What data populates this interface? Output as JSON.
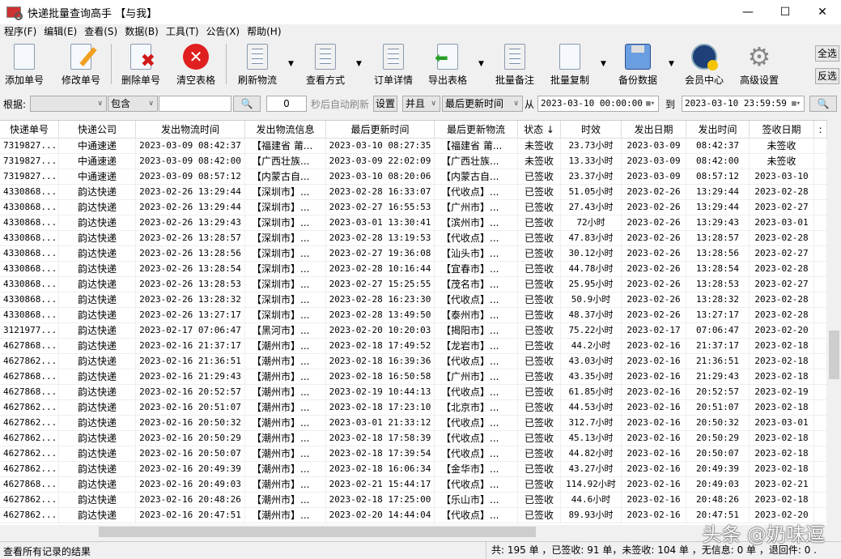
{
  "window": {
    "title": "快递批量查询高手 【与我】",
    "minimize": "—",
    "maximize": "☐",
    "close": "✕"
  },
  "menu": [
    "程序(F)",
    "编辑(E)",
    "查看(S)",
    "数据(B)",
    "工具(T)",
    "公告(X)",
    "帮助(H)"
  ],
  "toolbar": {
    "add": "添加单号",
    "edit": "修改单号",
    "delete": "删除单号",
    "clear": "清空表格",
    "refresh": "刷新物流",
    "view": "查看方式",
    "detail": "订单详情",
    "export": "导出表格",
    "remark": "批量备注",
    "copy": "批量复制",
    "backup": "备份数据",
    "member": "会员中心",
    "settings": "高级设置",
    "select_all": "全选",
    "invert": "反选"
  },
  "filter": {
    "by_label": "根据:",
    "by_value": "",
    "match": "包含",
    "keyword": "",
    "seconds": "0",
    "auto_refresh": "秒后自动刷新",
    "set": "设置",
    "logic": "并且",
    "field": "最后更新时间",
    "from_label": "从",
    "from": "2023-03-10 00:00:00",
    "to_label": "到",
    "to": "2023-03-10 23:59:59"
  },
  "columns": [
    "快递单号",
    "快递公司",
    "发出物流时间",
    "发出物流信息",
    "最后更新时间",
    "最后更新物流",
    "状态 ↓",
    "时效",
    "发出日期",
    "发出时间",
    "签收日期",
    ":"
  ],
  "rows": [
    [
      "7319827...",
      "中通速递",
      "2023-03-09 08:42:37",
      "【福建省 莆...",
      "2023-03-10 08:27:35",
      "【福建省 莆...",
      "未签收",
      "23.73小时",
      "2023-03-09",
      "08:42:37",
      "未签收"
    ],
    [
      "7319827...",
      "中通速递",
      "2023-03-09 08:42:00",
      "【广西壮族...",
      "2023-03-09 22:02:09",
      "【广西壮族...",
      "未签收",
      "13.33小时",
      "2023-03-09",
      "08:42:00",
      "未签收"
    ],
    [
      "7319827...",
      "中通速递",
      "2023-03-09 08:57:12",
      "【内蒙古自...",
      "2023-03-10 08:20:06",
      "【内蒙古自...",
      "已签收",
      "23.37小时",
      "2023-03-09",
      "08:57:12",
      "2023-03-10"
    ],
    [
      "4330868...",
      "韵达快递",
      "2023-02-26 13:29:44",
      "【深圳市】...",
      "2023-02-28 16:33:07",
      "【代收点】...",
      "已签收",
      "51.05小时",
      "2023-02-26",
      "13:29:44",
      "2023-02-28"
    ],
    [
      "4330868...",
      "韵达快递",
      "2023-02-26 13:29:44",
      "【深圳市】...",
      "2023-02-27 16:55:53",
      "【广州市】...",
      "已签收",
      "27.43小时",
      "2023-02-26",
      "13:29:44",
      "2023-02-27"
    ],
    [
      "4330868...",
      "韵达快递",
      "2023-02-26 13:29:43",
      "【深圳市】...",
      "2023-03-01 13:30:41",
      "【滨州市】...",
      "已签收",
      "72小时",
      "2023-02-26",
      "13:29:43",
      "2023-03-01"
    ],
    [
      "4330868...",
      "韵达快递",
      "2023-02-26 13:28:57",
      "【深圳市】...",
      "2023-02-28 13:19:53",
      "【代收点】...",
      "已签收",
      "47.83小时",
      "2023-02-26",
      "13:28:57",
      "2023-02-28"
    ],
    [
      "4330868...",
      "韵达快递",
      "2023-02-26 13:28:56",
      "【深圳市】...",
      "2023-02-27 19:36:08",
      "【汕头市】...",
      "已签收",
      "30.12小时",
      "2023-02-26",
      "13:28:56",
      "2023-02-27"
    ],
    [
      "4330868...",
      "韵达快递",
      "2023-02-26 13:28:54",
      "【深圳市】...",
      "2023-02-28 10:16:44",
      "【宜春市】...",
      "已签收",
      "44.78小时",
      "2023-02-26",
      "13:28:54",
      "2023-02-28"
    ],
    [
      "4330868...",
      "韵达快递",
      "2023-02-26 13:28:53",
      "【深圳市】...",
      "2023-02-27 15:25:55",
      "【茂名市】...",
      "已签收",
      "25.95小时",
      "2023-02-26",
      "13:28:53",
      "2023-02-27"
    ],
    [
      "4330868...",
      "韵达快递",
      "2023-02-26 13:28:32",
      "【深圳市】...",
      "2023-02-28 16:23:30",
      "【代收点】...",
      "已签收",
      "50.9小时",
      "2023-02-26",
      "13:28:32",
      "2023-02-28"
    ],
    [
      "4330868...",
      "韵达快递",
      "2023-02-26 13:27:17",
      "【深圳市】...",
      "2023-02-28 13:49:50",
      "【泰州市】...",
      "已签收",
      "48.37小时",
      "2023-02-26",
      "13:27:17",
      "2023-02-28"
    ],
    [
      "3121977...",
      "韵达快递",
      "2023-02-17 07:06:47",
      "【黑河市】...",
      "2023-02-20 10:20:03",
      "【揭阳市】...",
      "已签收",
      "75.22小时",
      "2023-02-17",
      "07:06:47",
      "2023-02-20"
    ],
    [
      "4627868...",
      "韵达快递",
      "2023-02-16 21:37:17",
      "【潮州市】...",
      "2023-02-18 17:49:52",
      "【龙岩市】...",
      "已签收",
      "44.2小时",
      "2023-02-16",
      "21:37:17",
      "2023-02-18"
    ],
    [
      "4627862...",
      "韵达快递",
      "2023-02-16 21:36:51",
      "【潮州市】...",
      "2023-02-18 16:39:36",
      "【代收点】...",
      "已签收",
      "43.03小时",
      "2023-02-16",
      "21:36:51",
      "2023-02-18"
    ],
    [
      "4627868...",
      "韵达快递",
      "2023-02-16 21:29:43",
      "【潮州市】...",
      "2023-02-18 16:50:58",
      "【广州市】...",
      "已签收",
      "43.35小时",
      "2023-02-16",
      "21:29:43",
      "2023-02-18"
    ],
    [
      "4627868...",
      "韵达快递",
      "2023-02-16 20:52:57",
      "【潮州市】...",
      "2023-02-19 10:44:13",
      "【代收点】...",
      "已签收",
      "61.85小时",
      "2023-02-16",
      "20:52:57",
      "2023-02-19"
    ],
    [
      "4627862...",
      "韵达快递",
      "2023-02-16 20:51:07",
      "【潮州市】...",
      "2023-02-18 17:23:10",
      "【北京市】...",
      "已签收",
      "44.53小时",
      "2023-02-16",
      "20:51:07",
      "2023-02-18"
    ],
    [
      "4627862...",
      "韵达快递",
      "2023-02-16 20:50:32",
      "【潮州市】...",
      "2023-03-01 21:33:12",
      "【代收点】...",
      "已签收",
      "312.7小时",
      "2023-02-16",
      "20:50:32",
      "2023-03-01"
    ],
    [
      "4627862...",
      "韵达快递",
      "2023-02-16 20:50:29",
      "【潮州市】...",
      "2023-02-18 17:58:39",
      "【代收点】...",
      "已签收",
      "45.13小时",
      "2023-02-16",
      "20:50:29",
      "2023-02-18"
    ],
    [
      "4627862...",
      "韵达快递",
      "2023-02-16 20:50:07",
      "【潮州市】...",
      "2023-02-18 17:39:54",
      "【代收点】...",
      "已签收",
      "44.82小时",
      "2023-02-16",
      "20:50:07",
      "2023-02-18"
    ],
    [
      "4627862...",
      "韵达快递",
      "2023-02-16 20:49:39",
      "【潮州市】...",
      "2023-02-18 16:06:34",
      "【金华市】...",
      "已签收",
      "43.27小时",
      "2023-02-16",
      "20:49:39",
      "2023-02-18"
    ],
    [
      "4627868...",
      "韵达快递",
      "2023-02-16 20:49:03",
      "【潮州市】...",
      "2023-02-21 15:44:17",
      "【代收点】...",
      "已签收",
      "114.92小时",
      "2023-02-16",
      "20:49:03",
      "2023-02-21"
    ],
    [
      "4627862...",
      "韵达快递",
      "2023-02-16 20:48:26",
      "【潮州市】...",
      "2023-02-18 17:25:00",
      "【乐山市】...",
      "已签收",
      "44.6小时",
      "2023-02-16",
      "20:48:26",
      "2023-02-18"
    ],
    [
      "4627862...",
      "韵达快递",
      "2023-02-16 20:47:51",
      "【潮州市】...",
      "2023-02-20 14:44:04",
      "【代收点】...",
      "已签收",
      "89.93小时",
      "2023-02-16",
      "20:47:51",
      "2023-02-20"
    ]
  ],
  "status": {
    "left": "查看所有记录的结果",
    "right": "共: 195 单 ，已签收: 91 单，未签收: 104 单 ，无信息: 0 单 ，退回件: 0 ."
  },
  "watermark": "头条 @奶味逗"
}
